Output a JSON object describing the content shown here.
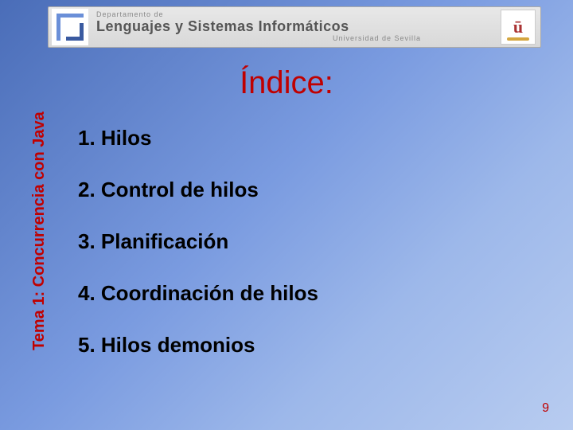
{
  "header": {
    "dept_line": "Departamento de",
    "main_line": "Lenguajes y Sistemas Informáticos",
    "uni_line": "Universidad de Sevilla",
    "uni_logo_letter": "ū"
  },
  "sidebar": {
    "label": "Tema 1: Concurrencia con Java"
  },
  "title": "Índice:",
  "items": [
    "1. Hilos",
    "2. Control de hilos",
    "3. Planificación",
    "4. Coordinación de hilos",
    "5. Hilos demonios"
  ],
  "page_number": "9"
}
